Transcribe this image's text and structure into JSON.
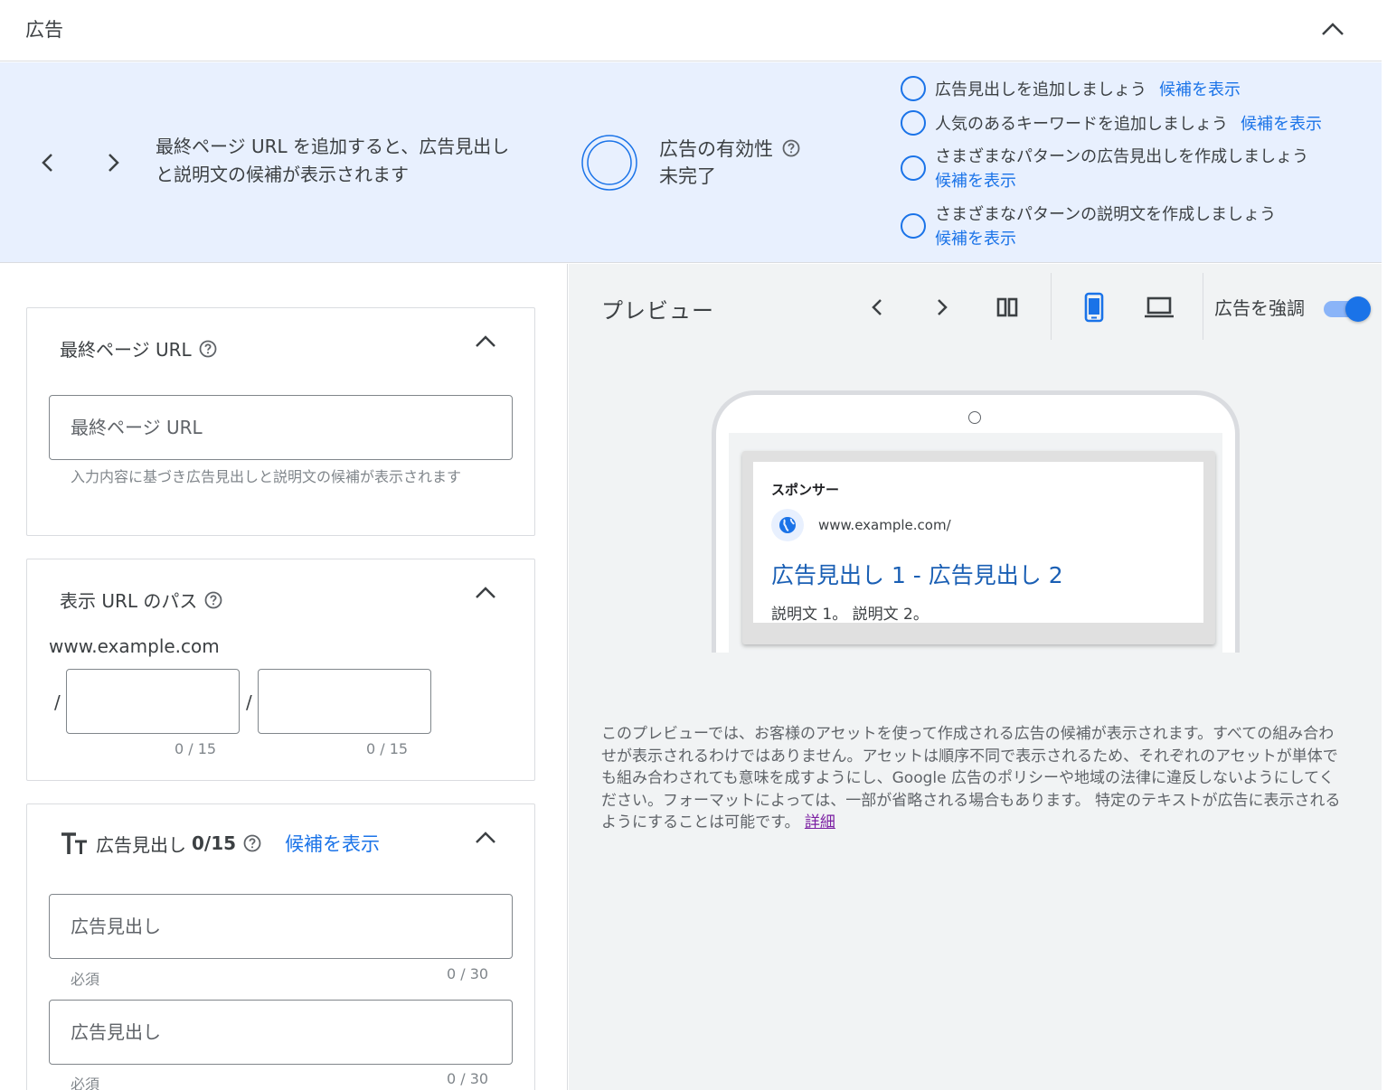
{
  "header": {
    "title": "広告"
  },
  "banner": {
    "message": "最終ページ URL を追加すると、広告見出しと説明文の候補が表示されます",
    "strength_label": "広告の有効性",
    "strength_status": "未完了",
    "checklist": [
      {
        "text": "広告見出しを追加しましょう",
        "link": "候補を表示"
      },
      {
        "text": "人気のあるキーワードを追加しましょう",
        "link": "候補を表示"
      },
      {
        "text": "さまざまなパターンの広告見出しを作成しましょう",
        "link": "候補を表示"
      },
      {
        "text": "さまざまなパターンの説明文を作成しましょう",
        "link": "候補を表示"
      }
    ]
  },
  "final_url": {
    "title": "最終ページ URL",
    "placeholder": "最終ページ URL",
    "hint": "入力内容に基づき広告見出しと説明文の候補が表示されます"
  },
  "display_path": {
    "title": "表示 URL のパス",
    "domain": "www.example.com",
    "separator": "/",
    "path1_counter": "0 / 15",
    "path2_counter": "0 / 15"
  },
  "headlines": {
    "title": "広告見出し",
    "count": "0/15",
    "suggest_link": "候補を表示",
    "fields": [
      {
        "placeholder": "広告見出し",
        "required": "必須",
        "counter": "0 / 30"
      },
      {
        "placeholder": "広告見出し",
        "required": "必須",
        "counter": "0 / 30"
      }
    ]
  },
  "preview": {
    "title": "プレビュー",
    "emphasize_label": "広告を強調",
    "emphasize_on": true,
    "active_device": "mobile",
    "ad": {
      "sponsor": "スポンサー",
      "url": "www.example.com/",
      "headline": "広告見出し 1 - 広告見出し 2",
      "description": "説明文 1。 説明文 2。"
    },
    "disclaimer": "このプレビューでは、お客様のアセットを使って作成される広告の候補が表示されます。すべての組み合わせが表示されるわけではありません。アセットは順序不同で表示されるため、それぞれのアセットが単体でも組み合わされても意味を成すようにし、Google 広告のポリシーや地域の法律に違反しないようにしてください。フォーマットによっては、一部が省略される場合もあります。 特定のテキストが広告に表示されるようにすることは可能です。",
    "details_link": "詳細"
  },
  "colors": {
    "accent": "#1a73e8",
    "banner_bg": "#e8f0fe",
    "preview_bg": "#f1f3f4",
    "link_visited": "#7b1fa2"
  }
}
